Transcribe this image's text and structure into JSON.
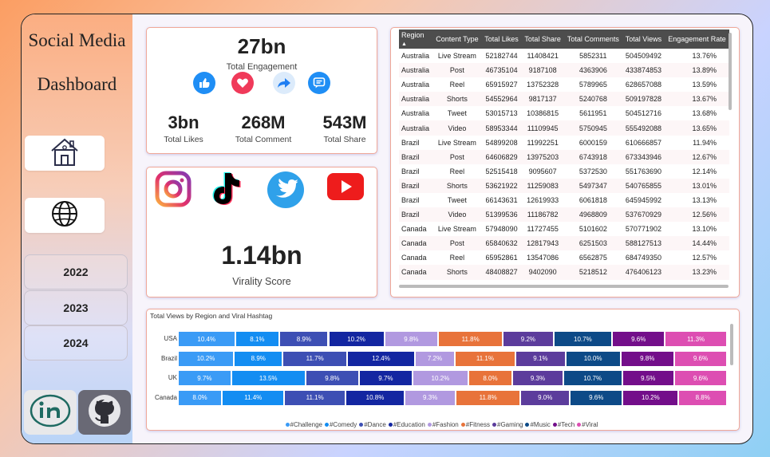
{
  "sidebar": {
    "title_line1": "Social Media",
    "title_line2": "Dashboard",
    "home_icon": "home-icon",
    "globe_icon": "globe-icon",
    "years": [
      "2022",
      "2023",
      "2024"
    ],
    "social_icons": [
      "linkedin-icon",
      "github-icon"
    ]
  },
  "engagement": {
    "value": "27bn",
    "label": "Total Engagement",
    "icons": [
      "like-icon",
      "heart-icon",
      "share-icon",
      "comment-icon"
    ],
    "likes_value": "3bn",
    "likes_label": "Total Likes",
    "comment_value": "268M",
    "comment_label": "Total Comment",
    "share_value": "543M",
    "share_label": "Total Share"
  },
  "virality": {
    "platform_icons": [
      "instagram-icon",
      "tiktok-icon",
      "twitter-icon",
      "youtube-icon"
    ],
    "value": "1.14bn",
    "label": "Virality Score"
  },
  "table": {
    "headers": [
      "Region",
      "Content Type",
      "Total Likes",
      "Total Share",
      "Total Comments",
      "Total Views",
      "Engagement Rate"
    ],
    "rows": [
      [
        "Australia",
        "Live Stream",
        "52182744",
        "11408421",
        "5852311",
        "504509492",
        "13.76%"
      ],
      [
        "Australia",
        "Post",
        "46735104",
        "9187108",
        "4363906",
        "433874853",
        "13.89%"
      ],
      [
        "Australia",
        "Reel",
        "65915927",
        "13752328",
        "5789965",
        "628657088",
        "13.59%"
      ],
      [
        "Australia",
        "Shorts",
        "54552964",
        "9817137",
        "5240768",
        "509197828",
        "13.67%"
      ],
      [
        "Australia",
        "Tweet",
        "53015713",
        "10386815",
        "5611951",
        "504512716",
        "13.68%"
      ],
      [
        "Australia",
        "Video",
        "58953344",
        "11109945",
        "5750945",
        "555492088",
        "13.65%"
      ],
      [
        "Brazil",
        "Live Stream",
        "54899208",
        "11992251",
        "6000159",
        "610666857",
        "11.94%"
      ],
      [
        "Brazil",
        "Post",
        "64606829",
        "13975203",
        "6743918",
        "673343946",
        "12.67%"
      ],
      [
        "Brazil",
        "Reel",
        "52515418",
        "9095607",
        "5372530",
        "551763690",
        "12.14%"
      ],
      [
        "Brazil",
        "Shorts",
        "53621922",
        "11259083",
        "5497347",
        "540765855",
        "13.01%"
      ],
      [
        "Brazil",
        "Tweet",
        "66143631",
        "12619933",
        "6061818",
        "645945992",
        "13.13%"
      ],
      [
        "Brazil",
        "Video",
        "51399536",
        "11186782",
        "4968809",
        "537670929",
        "12.56%"
      ],
      [
        "Canada",
        "Live Stream",
        "57948090",
        "11727455",
        "5101602",
        "570771902",
        "13.10%"
      ],
      [
        "Canada",
        "Post",
        "65840632",
        "12817943",
        "6251503",
        "588127513",
        "14.44%"
      ],
      [
        "Canada",
        "Reel",
        "65952861",
        "13547086",
        "6562875",
        "684749350",
        "12.57%"
      ],
      [
        "Canada",
        "Shorts",
        "48408827",
        "9402090",
        "5218512",
        "476406123",
        "13.23%"
      ]
    ]
  },
  "chart_data": {
    "type": "bar",
    "stacked": "100%",
    "orientation": "horizontal",
    "title": "Total Views by Region and Viral Hashtag",
    "categories": [
      "USA",
      "Brazil",
      "UK",
      "Canada"
    ],
    "series": [
      {
        "name": "#Challenge",
        "color": "#3a9bf6",
        "values": [
          10.4,
          10.2,
          9.7,
          8.0
        ]
      },
      {
        "name": "#Comedy",
        "color": "#138df2",
        "values": [
          8.1,
          8.9,
          13.5,
          11.4
        ]
      },
      {
        "name": "#Dance",
        "color": "#3d4fb4",
        "values": [
          8.9,
          11.7,
          9.8,
          11.1
        ]
      },
      {
        "name": "#Education",
        "color": "#1326a1",
        "values": [
          10.2,
          12.4,
          9.7,
          10.8
        ]
      },
      {
        "name": "#Fashion",
        "color": "#b199e0",
        "values": [
          9.8,
          7.2,
          10.2,
          9.3
        ]
      },
      {
        "name": "#Fitness",
        "color": "#e8733a",
        "values": [
          11.8,
          11.1,
          8.0,
          11.8
        ]
      },
      {
        "name": "#Gaming",
        "color": "#5c3c9c",
        "values": [
          9.2,
          9.1,
          9.3,
          9.0
        ]
      },
      {
        "name": "#Music",
        "color": "#0d4a87",
        "values": [
          10.7,
          10.0,
          10.7,
          9.6
        ]
      },
      {
        "name": "#Tech",
        "color": "#730e8a",
        "values": [
          9.6,
          9.8,
          9.5,
          10.2
        ]
      },
      {
        "name": "#Viral",
        "color": "#dd4eb2",
        "values": [
          11.3,
          9.6,
          9.6,
          8.8
        ]
      }
    ],
    "legend": "bottom"
  }
}
